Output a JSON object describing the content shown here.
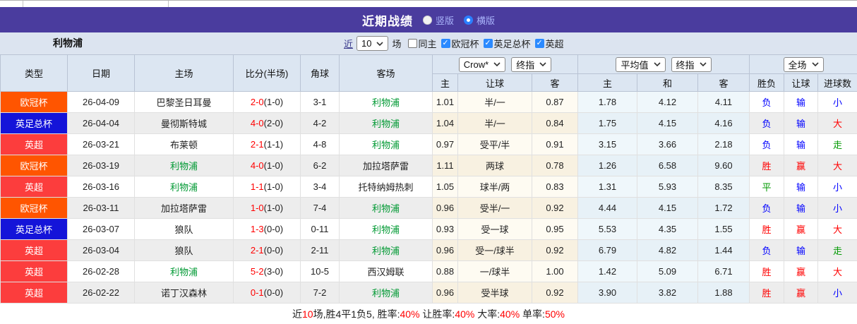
{
  "header": {
    "title": "近期战绩",
    "layout_options": [
      {
        "label": "竖版",
        "selected": false
      },
      {
        "label": "横版",
        "selected": true
      }
    ]
  },
  "controls": {
    "team_name": "利物浦",
    "recent_label": "近",
    "recent_count": "10",
    "matches_label": "场",
    "checkboxes": [
      {
        "label": "同主",
        "checked": false
      },
      {
        "label": "欧冠杯",
        "checked": true
      },
      {
        "label": "英足总杯",
        "checked": true
      },
      {
        "label": "英超",
        "checked": true
      }
    ]
  },
  "colors": {
    "accent_purple": "#4a3c9e",
    "win_red": "#ff0000",
    "loss_blue": "#0000ff",
    "draw_green": "#009900",
    "team_green": "#009933",
    "black": "#222222",
    "ucl_orange": "#ff5500",
    "facup_blue": "#1414d9",
    "epl_red": "#fc3d3d"
  },
  "table": {
    "selects": {
      "odds_company": "Crow*",
      "odds_time": "终指",
      "europe_type": "平均值",
      "europe_time": "终指",
      "result_scope": "全场"
    },
    "columns": [
      "类型",
      "日期",
      "主场",
      "比分(半场)",
      "角球",
      "客场",
      "主",
      "让球",
      "客",
      "主",
      "和",
      "客",
      "胜负",
      "让球",
      "进球数"
    ],
    "rows": [
      {
        "type": "欧冠杯",
        "type_color": "ucl_orange",
        "date": "26-04-09",
        "home": "巴黎圣日耳曼",
        "home_color": "black",
        "score": "2-0",
        "half": "(1-0)",
        "corner": "3-1",
        "away": "利物浦",
        "away_color": "team_green",
        "asia_home": "1.01",
        "handicap": "半/一",
        "asia_away": "0.87",
        "eu_home": "1.78",
        "eu_draw": "4.12",
        "eu_away": "4.11",
        "wdl": "负",
        "wdl_color": "loss_blue",
        "hcap": "输",
        "hcap_color": "loss_blue",
        "goals": "小",
        "goals_color": "loss_blue"
      },
      {
        "type": "英足总杯",
        "type_color": "facup_blue",
        "date": "26-04-04",
        "home": "曼彻斯特城",
        "home_color": "black",
        "score": "4-0",
        "half": "(2-0)",
        "corner": "4-2",
        "away": "利物浦",
        "away_color": "team_green",
        "asia_home": "1.04",
        "handicap": "半/一",
        "asia_away": "0.84",
        "eu_home": "1.75",
        "eu_draw": "4.15",
        "eu_away": "4.16",
        "wdl": "负",
        "wdl_color": "loss_blue",
        "hcap": "输",
        "hcap_color": "loss_blue",
        "goals": "大",
        "goals_color": "win_red"
      },
      {
        "type": "英超",
        "type_color": "epl_red",
        "date": "26-03-21",
        "home": "布莱顿",
        "home_color": "black",
        "score": "2-1",
        "half": "(1-1)",
        "corner": "4-8",
        "away": "利物浦",
        "away_color": "team_green",
        "asia_home": "0.97",
        "handicap": "受平/半",
        "asia_away": "0.91",
        "eu_home": "3.15",
        "eu_draw": "3.66",
        "eu_away": "2.18",
        "wdl": "负",
        "wdl_color": "loss_blue",
        "hcap": "输",
        "hcap_color": "loss_blue",
        "goals": "走",
        "goals_color": "draw_green"
      },
      {
        "type": "欧冠杯",
        "type_color": "ucl_orange",
        "date": "26-03-19",
        "home": "利物浦",
        "home_color": "team_green",
        "score": "4-0",
        "half": "(1-0)",
        "corner": "6-2",
        "away": "加拉塔萨雷",
        "away_color": "black",
        "asia_home": "1.11",
        "handicap": "两球",
        "asia_away": "0.78",
        "eu_home": "1.26",
        "eu_draw": "6.58",
        "eu_away": "9.60",
        "wdl": "胜",
        "wdl_color": "win_red",
        "hcap": "赢",
        "hcap_color": "win_red",
        "goals": "大",
        "goals_color": "win_red"
      },
      {
        "type": "英超",
        "type_color": "epl_red",
        "date": "26-03-16",
        "home": "利物浦",
        "home_color": "team_green",
        "score": "1-1",
        "half": "(1-0)",
        "corner": "3-4",
        "away": "托特纳姆热刺",
        "away_color": "black",
        "asia_home": "1.05",
        "handicap": "球半/两",
        "asia_away": "0.83",
        "eu_home": "1.31",
        "eu_draw": "5.93",
        "eu_away": "8.35",
        "wdl": "平",
        "wdl_color": "draw_green",
        "hcap": "输",
        "hcap_color": "loss_blue",
        "goals": "小",
        "goals_color": "loss_blue"
      },
      {
        "type": "欧冠杯",
        "type_color": "ucl_orange",
        "date": "26-03-11",
        "home": "加拉塔萨雷",
        "home_color": "black",
        "score": "1-0",
        "half": "(1-0)",
        "corner": "7-4",
        "away": "利物浦",
        "away_color": "team_green",
        "asia_home": "0.96",
        "handicap": "受半/一",
        "asia_away": "0.92",
        "eu_home": "4.44",
        "eu_draw": "4.15",
        "eu_away": "1.72",
        "wdl": "负",
        "wdl_color": "loss_blue",
        "hcap": "输",
        "hcap_color": "loss_blue",
        "goals": "小",
        "goals_color": "loss_blue"
      },
      {
        "type": "英足总杯",
        "type_color": "facup_blue",
        "date": "26-03-07",
        "home": "狼队",
        "home_color": "black",
        "score": "1-3",
        "half": "(0-0)",
        "corner": "0-11",
        "away": "利物浦",
        "away_color": "team_green",
        "asia_home": "0.93",
        "handicap": "受一球",
        "asia_away": "0.95",
        "eu_home": "5.53",
        "eu_draw": "4.35",
        "eu_away": "1.55",
        "wdl": "胜",
        "wdl_color": "win_red",
        "hcap": "赢",
        "hcap_color": "win_red",
        "goals": "大",
        "goals_color": "win_red"
      },
      {
        "type": "英超",
        "type_color": "epl_red",
        "date": "26-03-04",
        "home": "狼队",
        "home_color": "black",
        "score": "2-1",
        "half": "(0-0)",
        "corner": "2-11",
        "away": "利物浦",
        "away_color": "team_green",
        "asia_home": "0.96",
        "handicap": "受一/球半",
        "asia_away": "0.92",
        "eu_home": "6.79",
        "eu_draw": "4.82",
        "eu_away": "1.44",
        "wdl": "负",
        "wdl_color": "loss_blue",
        "hcap": "输",
        "hcap_color": "loss_blue",
        "goals": "走",
        "goals_color": "draw_green"
      },
      {
        "type": "英超",
        "type_color": "epl_red",
        "date": "26-02-28",
        "home": "利物浦",
        "home_color": "team_green",
        "score": "5-2",
        "half": "(3-0)",
        "corner": "10-5",
        "away": "西汉姆联",
        "away_color": "black",
        "asia_home": "0.88",
        "handicap": "一/球半",
        "asia_away": "1.00",
        "eu_home": "1.42",
        "eu_draw": "5.09",
        "eu_away": "6.71",
        "wdl": "胜",
        "wdl_color": "win_red",
        "hcap": "赢",
        "hcap_color": "win_red",
        "goals": "大",
        "goals_color": "win_red"
      },
      {
        "type": "英超",
        "type_color": "epl_red",
        "date": "26-02-22",
        "home": "诺丁汉森林",
        "home_color": "black",
        "score": "0-1",
        "half": "(0-0)",
        "corner": "7-2",
        "away": "利物浦",
        "away_color": "team_green",
        "asia_home": "0.96",
        "handicap": "受半球",
        "asia_away": "0.92",
        "eu_home": "3.90",
        "eu_draw": "3.82",
        "eu_away": "1.88",
        "wdl": "胜",
        "wdl_color": "win_red",
        "hcap": "赢",
        "hcap_color": "win_red",
        "goals": "小",
        "goals_color": "loss_blue"
      }
    ]
  },
  "footer": {
    "parts": [
      {
        "text": "近",
        "highlight": false
      },
      {
        "text": "10",
        "highlight": true
      },
      {
        "text": "场,胜4平1负5, 胜率:",
        "highlight": false
      },
      {
        "text": "40%",
        "highlight": true
      },
      {
        "text": " 让胜率:",
        "highlight": false
      },
      {
        "text": "40%",
        "highlight": true
      },
      {
        "text": " 大率:",
        "highlight": false
      },
      {
        "text": "40%",
        "highlight": true
      },
      {
        "text": " 单率:",
        "highlight": false
      },
      {
        "text": "50%",
        "highlight": true
      }
    ]
  }
}
